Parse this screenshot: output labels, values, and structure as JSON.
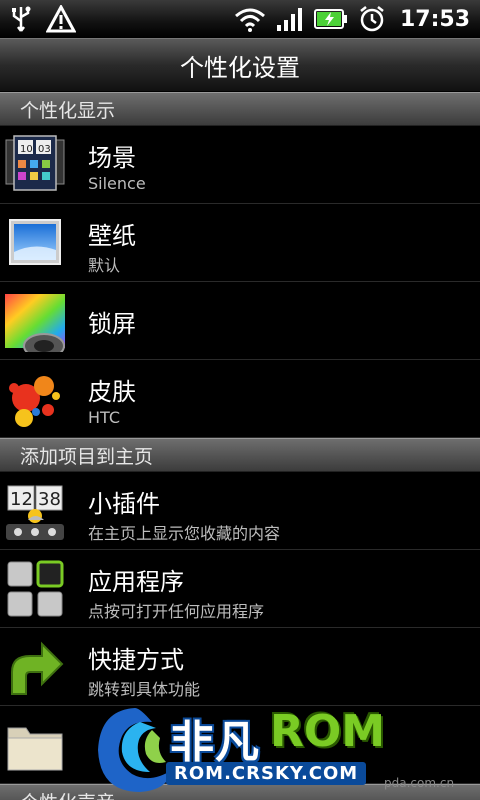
{
  "status": {
    "time": "17:53"
  },
  "title": "个性化设置",
  "sections": [
    {
      "label": "个性化显示"
    },
    {
      "label": "添加项目到主页"
    },
    {
      "label": "个性化声音"
    }
  ],
  "items": [
    {
      "title": "场景",
      "sub": "Silence",
      "icon": "scene-icon"
    },
    {
      "title": "壁纸",
      "sub": "默认",
      "icon": "wallpaper-icon"
    },
    {
      "title": "锁屏",
      "sub": "",
      "icon": "lockscreen-icon"
    },
    {
      "title": "皮肤",
      "sub": "HTC",
      "icon": "skin-icon"
    },
    {
      "title": "小插件",
      "sub": "在主页上显示您收藏的内容",
      "icon": "widget-icon"
    },
    {
      "title": "应用程序",
      "sub": "点按可打开任何应用程序",
      "icon": "apps-icon"
    },
    {
      "title": "快捷方式",
      "sub": "跳转到具体功能",
      "icon": "shortcut-arrow-icon"
    },
    {
      "title": "",
      "sub": "",
      "icon": "folder-icon"
    }
  ],
  "watermark": {
    "brand": "非凡",
    "rom": "ROM",
    "url": "ROM.CRSKY.COM",
    "small": "pda.com.cn"
  },
  "colors": {
    "battery": "#4cd137",
    "rom_green": "#7acb24",
    "brand_blue": "#0a4a9a"
  }
}
